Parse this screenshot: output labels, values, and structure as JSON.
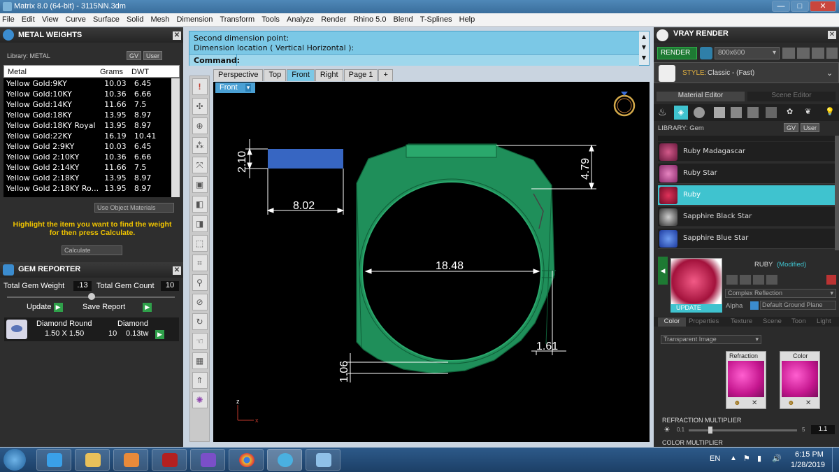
{
  "window": {
    "title": "Matrix 8.0 (64-bit) - 3115NN.3dm",
    "min": "—",
    "max": "□",
    "close": "✕"
  },
  "menu": [
    "File",
    "Edit",
    "View",
    "Curve",
    "Surface",
    "Solid",
    "Mesh",
    "Dimension",
    "Transform",
    "Tools",
    "Analyze",
    "Render",
    "Rhino 5.0",
    "Blend",
    "T-Splines",
    "Help"
  ],
  "metal_weights": {
    "title": "METAL WEIGHTS",
    "library_label": "Library: METAL",
    "gv": "GV",
    "user": "User",
    "columns": [
      "Metal",
      "Grams",
      "DWT"
    ],
    "rows": [
      [
        "Yellow Gold:9KY",
        "10.03",
        "6.45"
      ],
      [
        "Yellow Gold:10KY",
        "10.36",
        "6.66"
      ],
      [
        "Yellow Gold:14KY",
        "11.66",
        "7.5"
      ],
      [
        "Yellow Gold:18KY",
        "13.95",
        "8.97"
      ],
      [
        "Yellow Gold:18KY Royal",
        "13.95",
        "8.97"
      ],
      [
        "Yellow Gold:22KY",
        "16.19",
        "10.41"
      ],
      [
        "Yellow Gold 2:9KY",
        "10.03",
        "6.45"
      ],
      [
        "Yellow Gold 2:10KY",
        "10.36",
        "6.66"
      ],
      [
        "Yellow Gold 2:14KY",
        "11.66",
        "7.5"
      ],
      [
        "Yellow Gold 2:18KY",
        "13.95",
        "8.97"
      ],
      [
        "Yellow Gold 2:18KY Ro...",
        "13.95",
        "8.97"
      ]
    ],
    "use_object_materials": "Use Object Materials",
    "hint": "Highlight the item you want to find the weight for then press Calculate.",
    "calculate": "Calculate"
  },
  "gem_reporter": {
    "title": "GEM REPORTER",
    "total_weight_label": "Total Gem Weight",
    "total_weight": ".13",
    "total_count_label": "Total Gem Count",
    "total_count": "10",
    "update": "Update",
    "save_report": "Save Report",
    "gem_name": "Diamond Round",
    "gem_type": "Diamond",
    "gem_size": "1.50 X 1.50",
    "gem_count": "10",
    "gem_weight": "0.13tw"
  },
  "command": {
    "line1": "Second dimension point:",
    "line2": "Dimension location ( Vertical  Horizontal ):",
    "prompt": "Command:"
  },
  "view_tabs": [
    "Perspective",
    "Top",
    "Front",
    "Right",
    "Page 1",
    "+"
  ],
  "active_view": "Front",
  "dimensions": {
    "bar_height": "2.10",
    "bar_width": "8.02",
    "top_height": "4.79",
    "inner_diameter": "18.48",
    "side_width": "1.61",
    "bottom_thickness": "1.06"
  },
  "axes": {
    "z": "z",
    "x": "x"
  },
  "vray": {
    "title": "VRAY RENDER",
    "render": "RENDER",
    "resolution": "800x600",
    "style_label": "STYLE:",
    "style_value": "Classic - (Fast)",
    "tab_material": "Material Editor",
    "tab_scene": "Scene Editor",
    "library": "LIBRARY: Gem",
    "gv": "GV",
    "user": "User",
    "materials": [
      "Ruby Madagascar",
      "Ruby Star",
      "Ruby",
      "Sapphire Black Star",
      "Sapphire Blue Star"
    ],
    "selected": "Ruby",
    "mat_name": "RUBY",
    "modified": "(Modified)",
    "update": "UPDATE",
    "reflection": "Complex Reflection",
    "alpha": "Alpha",
    "ground": "Default Ground Plane",
    "subtabs": [
      "Color",
      "Properties",
      "Texture",
      "Scene",
      "Toon",
      "Light"
    ],
    "transparent": "Transparent Image",
    "refraction": "Refraction",
    "color": "Color",
    "refr_mult": "REFRACTION MULTIPLIER",
    "mult_min": "0.1",
    "mult_max": "5",
    "mult_value": "1.1",
    "color_mult": "COLOR MULTIPLIER"
  },
  "taskbar": {
    "lang": "EN",
    "time": "6:15 PM",
    "date": "1/28/2019"
  }
}
